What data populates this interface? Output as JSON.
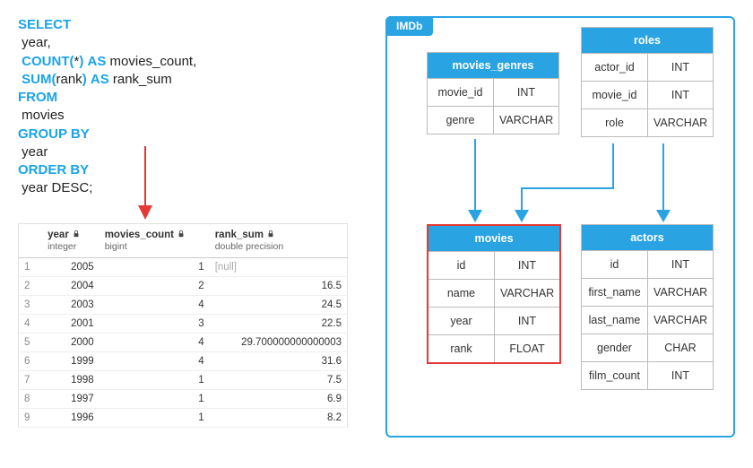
{
  "sql": {
    "kw_select": "SELECT",
    "f1": "year,",
    "kw_count": "COUNT(",
    "count_star": "*",
    "count_close": ")",
    "kw_as1": "AS",
    "f2": "movies_count,",
    "kw_sum": "SUM(",
    "sum_arg": "rank",
    "sum_close": ")",
    "kw_as2": "AS",
    "f3": "rank_sum",
    "kw_from": "FROM",
    "tbl": "movies",
    "kw_group": "GROUP BY",
    "g1": "year",
    "kw_order": "ORDER BY",
    "o1": "year DESC;"
  },
  "result": {
    "headers": [
      {
        "name": "year",
        "type": "integer"
      },
      {
        "name": "movies_count",
        "type": "bigint"
      },
      {
        "name": "rank_sum",
        "type": "double precision"
      }
    ],
    "rows": [
      {
        "idx": "1",
        "year": "2005",
        "mc": "1",
        "rs": "[null]",
        "null": true
      },
      {
        "idx": "2",
        "year": "2004",
        "mc": "2",
        "rs": "16.5"
      },
      {
        "idx": "3",
        "year": "2003",
        "mc": "4",
        "rs": "24.5"
      },
      {
        "idx": "4",
        "year": "2001",
        "mc": "3",
        "rs": "22.5"
      },
      {
        "idx": "5",
        "year": "2000",
        "mc": "4",
        "rs": "29.700000000000003"
      },
      {
        "idx": "6",
        "year": "1999",
        "mc": "4",
        "rs": "31.6"
      },
      {
        "idx": "7",
        "year": "1998",
        "mc": "1",
        "rs": "7.5"
      },
      {
        "idx": "8",
        "year": "1997",
        "mc": "1",
        "rs": "6.9"
      },
      {
        "idx": "9",
        "year": "1996",
        "mc": "1",
        "rs": "8.2"
      }
    ]
  },
  "schema": {
    "label": "IMDb",
    "tables": {
      "movies_genres": {
        "title": "movies_genres",
        "cols": [
          [
            "movie_id",
            "INT"
          ],
          [
            "genre",
            "VARCHAR"
          ]
        ]
      },
      "roles": {
        "title": "roles",
        "cols": [
          [
            "actor_id",
            "INT"
          ],
          [
            "movie_id",
            "INT"
          ],
          [
            "role",
            "VARCHAR"
          ]
        ]
      },
      "movies": {
        "title": "movies",
        "cols": [
          [
            "id",
            "INT"
          ],
          [
            "name",
            "VARCHAR"
          ],
          [
            "year",
            "INT"
          ],
          [
            "rank",
            "FLOAT"
          ]
        ]
      },
      "actors": {
        "title": "actors",
        "cols": [
          [
            "id",
            "INT"
          ],
          [
            "first_name",
            "VARCHAR"
          ],
          [
            "last_name",
            "VARCHAR"
          ],
          [
            "gender",
            "CHAR"
          ],
          [
            "film_count",
            "INT"
          ]
        ]
      }
    }
  }
}
